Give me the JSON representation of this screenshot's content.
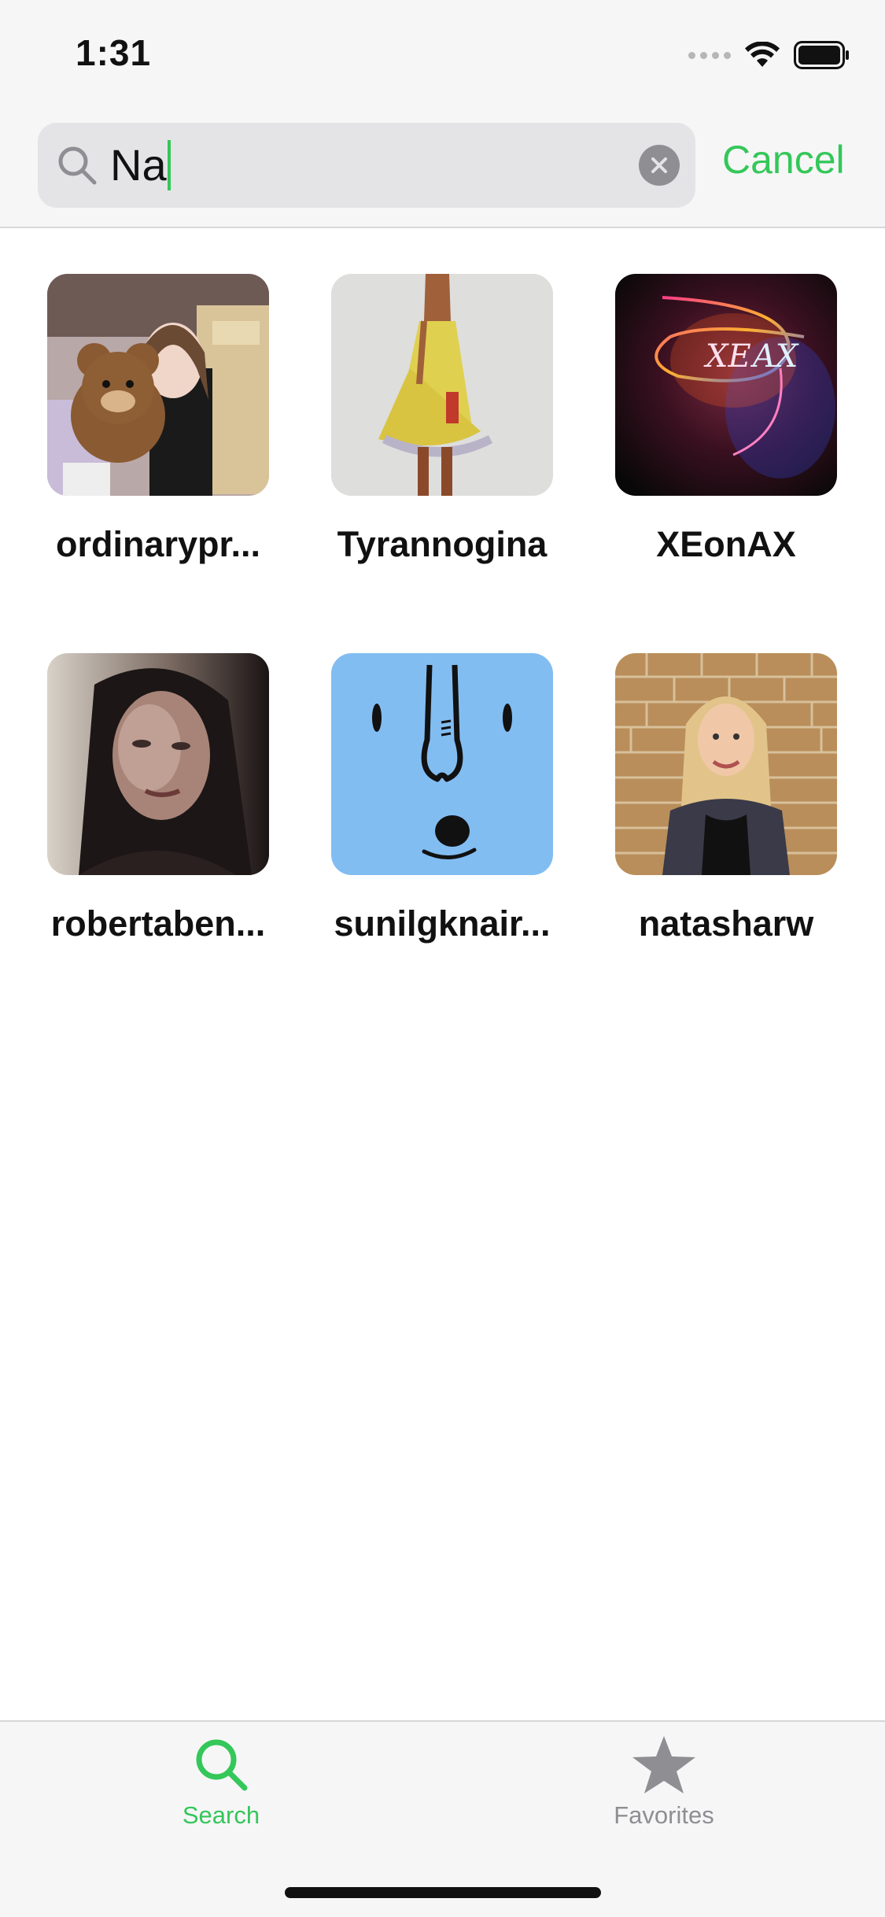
{
  "status_bar": {
    "time": "1:31"
  },
  "search": {
    "query": "Na",
    "cancel_label": "Cancel"
  },
  "results": [
    {
      "name": "ordinarypr...",
      "avatar": "woman-with-teddy-bear-photo"
    },
    {
      "name": "Tyrannogina",
      "avatar": "yellow-dress-painting"
    },
    {
      "name": "XEonAX",
      "avatar": "neon-logo"
    },
    {
      "name": "robertaben...",
      "avatar": "dark-portrait-photo"
    },
    {
      "name": "sunilgknair...",
      "avatar": "blue-cartoon-face"
    },
    {
      "name": "natasharw",
      "avatar": "woman-brick-wall-photo"
    }
  ],
  "tab_bar": {
    "tabs": [
      {
        "label": "Search",
        "icon": "search-icon",
        "active": true
      },
      {
        "label": "Favorites",
        "icon": "star-icon",
        "active": false
      }
    ]
  },
  "colors": {
    "accent": "#34c759",
    "inactive": "#8e8e93"
  }
}
